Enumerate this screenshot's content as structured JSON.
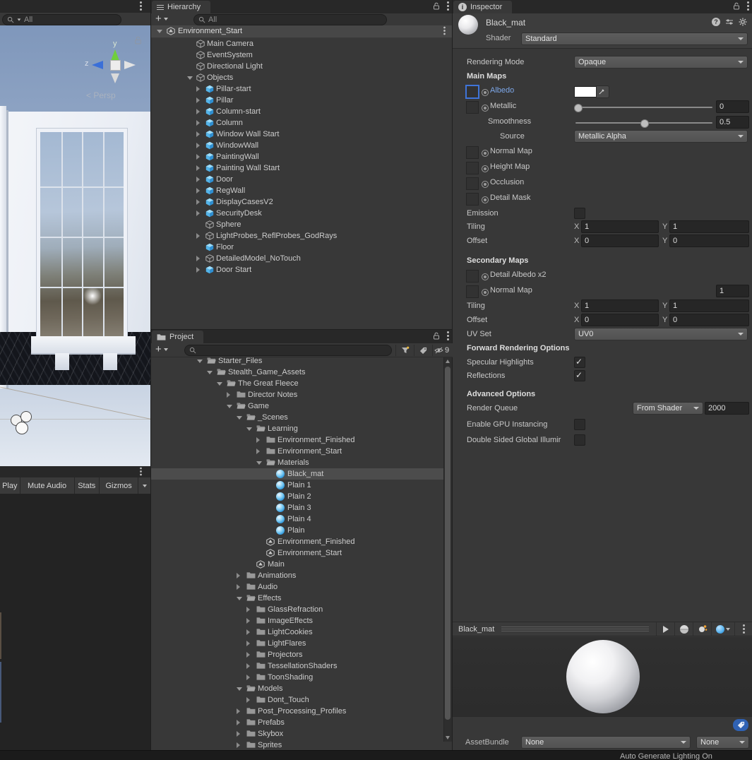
{
  "scene": {
    "search_placeholder": "All",
    "persp_label": "Persp",
    "axis_y_label": "y",
    "axis_z_label": "z"
  },
  "game": {
    "toolbar": {
      "play": "Play",
      "mute": "Mute Audio",
      "stats": "Stats",
      "gizmos": "Gizmos"
    }
  },
  "hierarchy": {
    "tab_label": "Hierarchy",
    "search_placeholder": "All",
    "scene_root": "Environment_Start",
    "rows": [
      {
        "label": "Main Camera",
        "icon": "cube-gray",
        "depth": 1
      },
      {
        "label": "EventSystem",
        "icon": "cube-gray",
        "depth": 1
      },
      {
        "label": "Directional Light",
        "icon": "cube-gray",
        "depth": 1
      },
      {
        "label": "Objects",
        "icon": "cube-gray",
        "depth": 1,
        "arrow": "open"
      },
      {
        "label": "Pillar-start",
        "icon": "cube-blue",
        "depth": 2,
        "arrow": "closed"
      },
      {
        "label": "Pillar",
        "icon": "cube-blue",
        "depth": 2,
        "arrow": "closed"
      },
      {
        "label": "Column-start",
        "icon": "cube-blue",
        "depth": 2,
        "arrow": "closed"
      },
      {
        "label": "Column",
        "icon": "cube-blue",
        "depth": 2,
        "arrow": "closed"
      },
      {
        "label": "Window Wall Start",
        "icon": "cube-blue",
        "depth": 2,
        "arrow": "closed"
      },
      {
        "label": "WindowWall",
        "icon": "cube-blue",
        "depth": 2,
        "arrow": "closed"
      },
      {
        "label": "PaintingWall",
        "icon": "cube-blue",
        "depth": 2,
        "arrow": "closed"
      },
      {
        "label": "Painting Wall Start",
        "icon": "cube-blue",
        "depth": 2,
        "arrow": "closed"
      },
      {
        "label": "Door",
        "icon": "cube-blue",
        "depth": 2,
        "arrow": "closed"
      },
      {
        "label": "RegWall",
        "icon": "cube-blue",
        "depth": 2,
        "arrow": "closed"
      },
      {
        "label": "DisplayCasesV2",
        "icon": "cube-blue",
        "depth": 2,
        "arrow": "closed"
      },
      {
        "label": "SecurityDesk",
        "icon": "cube-blue",
        "depth": 2,
        "arrow": "closed"
      },
      {
        "label": "Sphere",
        "icon": "cube-gray",
        "depth": 2
      },
      {
        "label": "LightProbes_ReflProbes_GodRays",
        "icon": "cube-gray",
        "depth": 2,
        "arrow": "closed"
      },
      {
        "label": "Floor",
        "icon": "cube-blue",
        "depth": 2
      },
      {
        "label": "DetailedModel_NoTouch",
        "icon": "cube-gray",
        "depth": 2,
        "arrow": "closed"
      },
      {
        "label": "Door Start",
        "icon": "cube-blue",
        "depth": 2,
        "arrow": "closed"
      }
    ]
  },
  "project": {
    "tab_label": "Project",
    "hidden_count": "9",
    "rows": [
      {
        "label": "Starter_Files",
        "icon": "folder-open",
        "depth": 0,
        "arrow": "open"
      },
      {
        "label": "Stealth_Game_Assets",
        "icon": "folder-open",
        "depth": 1,
        "arrow": "open"
      },
      {
        "label": "The Great Fleece",
        "icon": "folder-open",
        "depth": 2,
        "arrow": "open"
      },
      {
        "label": "Director Notes",
        "icon": "folder",
        "depth": 3,
        "arrow": "closed"
      },
      {
        "label": "Game",
        "icon": "folder-open",
        "depth": 3,
        "arrow": "open"
      },
      {
        "label": "_Scenes",
        "icon": "folder-open",
        "depth": 4,
        "arrow": "open"
      },
      {
        "label": "Learning",
        "icon": "folder-open",
        "depth": 5,
        "arrow": "open"
      },
      {
        "label": "Environment_Finished",
        "icon": "folder",
        "depth": 6,
        "arrow": "closed"
      },
      {
        "label": "Environment_Start",
        "icon": "folder",
        "depth": 6,
        "arrow": "closed"
      },
      {
        "label": "Materials",
        "icon": "folder-open",
        "depth": 6,
        "arrow": "open"
      },
      {
        "label": "Black_mat",
        "icon": "material",
        "depth": 7,
        "selected": true
      },
      {
        "label": "Plain 1",
        "icon": "material",
        "depth": 7
      },
      {
        "label": "Plain 2",
        "icon": "material",
        "depth": 7
      },
      {
        "label": "Plain 3",
        "icon": "material",
        "depth": 7
      },
      {
        "label": "Plain 4",
        "icon": "material",
        "depth": 7
      },
      {
        "label": "Plain",
        "icon": "material",
        "depth": 7
      },
      {
        "label": "Environment_Finished",
        "icon": "scene",
        "depth": 6
      },
      {
        "label": "Environment_Start",
        "icon": "scene",
        "depth": 6
      },
      {
        "label": "Main",
        "icon": "scene",
        "depth": 5
      },
      {
        "label": "Animations",
        "icon": "folder",
        "depth": 4,
        "arrow": "closed"
      },
      {
        "label": "Audio",
        "icon": "folder",
        "depth": 4,
        "arrow": "closed"
      },
      {
        "label": "Effects",
        "icon": "folder-open",
        "depth": 4,
        "arrow": "open"
      },
      {
        "label": "GlassRefraction",
        "icon": "folder",
        "depth": 5,
        "arrow": "closed"
      },
      {
        "label": "ImageEffects",
        "icon": "folder",
        "depth": 5,
        "arrow": "closed"
      },
      {
        "label": "LightCookies",
        "icon": "folder",
        "depth": 5,
        "arrow": "closed"
      },
      {
        "label": "LightFlares",
        "icon": "folder",
        "depth": 5,
        "arrow": "closed"
      },
      {
        "label": "Projectors",
        "icon": "folder",
        "depth": 5,
        "arrow": "closed"
      },
      {
        "label": "TessellationShaders",
        "icon": "folder",
        "depth": 5,
        "arrow": "closed"
      },
      {
        "label": "ToonShading",
        "icon": "folder",
        "depth": 5,
        "arrow": "closed"
      },
      {
        "label": "Models",
        "icon": "folder-open",
        "depth": 4,
        "arrow": "open"
      },
      {
        "label": "Dont_Touch",
        "icon": "folder",
        "depth": 5,
        "arrow": "closed"
      },
      {
        "label": "Post_Processing_Profiles",
        "icon": "folder",
        "depth": 4,
        "arrow": "closed"
      },
      {
        "label": "Prefabs",
        "icon": "folder",
        "depth": 4,
        "arrow": "closed"
      },
      {
        "label": "Skybox",
        "icon": "folder",
        "depth": 4,
        "arrow": "closed"
      },
      {
        "label": "Sprites",
        "icon": "folder",
        "depth": 4,
        "arrow": "closed"
      }
    ]
  },
  "inspector": {
    "tab_label": "Inspector",
    "material_name": "Black_mat",
    "shader_label": "Shader",
    "shader_value": "Standard",
    "rendering_mode_label": "Rendering Mode",
    "rendering_mode_value": "Opaque",
    "main_maps_header": "Main Maps",
    "albedo_label": "Albedo",
    "metallic_label": "Metallic",
    "metallic_value": "0",
    "smoothness_label": "Smoothness",
    "smoothness_value": "0.5",
    "source_label": "Source",
    "source_value": "Metallic Alpha",
    "normal_map_label": "Normal Map",
    "height_map_label": "Height Map",
    "occlusion_label": "Occlusion",
    "detail_mask_label": "Detail Mask",
    "emission_label": "Emission",
    "tiling_label": "Tiling",
    "offset_label": "Offset",
    "x_label": "X",
    "y_label": "Y",
    "main_tiling_x": "1",
    "main_tiling_y": "1",
    "main_offset_x": "0",
    "main_offset_y": "0",
    "secondary_maps_header": "Secondary Maps",
    "detail_albedo_label": "Detail Albedo x2",
    "secondary_normal_label": "Normal Map",
    "secondary_normal_value": "1",
    "secondary_tiling_x": "1",
    "secondary_tiling_y": "1",
    "secondary_offset_x": "0",
    "secondary_offset_y": "0",
    "uv_set_label": "UV Set",
    "uv_set_value": "UV0",
    "forward_header": "Forward Rendering Options",
    "specular_label": "Specular Highlights",
    "reflections_label": "Reflections",
    "advanced_header": "Advanced Options",
    "render_queue_label": "Render Queue",
    "render_queue_mode": "From Shader",
    "render_queue_value": "2000",
    "gpu_instancing_label": "Enable GPU Instancing",
    "double_sided_gi_label": "Double Sided Global Illumir"
  },
  "preview": {
    "title": "Black_mat"
  },
  "asset_bundle": {
    "label": "AssetBundle",
    "bundle_value": "None",
    "variant_value": "None"
  },
  "status_bar": {
    "lighting_status": "Auto Generate Lighting On"
  }
}
